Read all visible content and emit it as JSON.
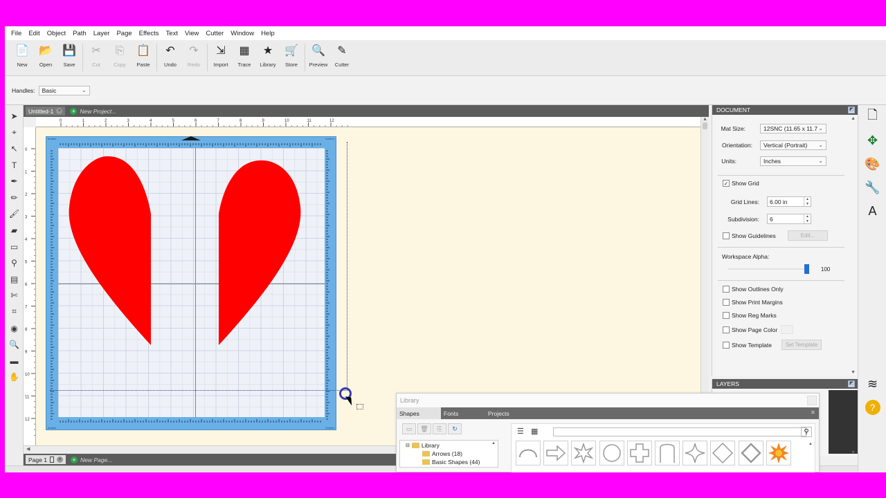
{
  "menu": [
    "File",
    "Edit",
    "Object",
    "Path",
    "Layer",
    "Page",
    "Effects",
    "Text",
    "View",
    "Cutter",
    "Window",
    "Help"
  ],
  "toolbar": [
    {
      "label": "New",
      "icon": "new-icon",
      "glyph": "📄",
      "enabled": true
    },
    {
      "label": "Open",
      "icon": "open-icon",
      "glyph": "📂",
      "enabled": true
    },
    {
      "label": "Save",
      "icon": "save-icon",
      "glyph": "💾",
      "enabled": true
    },
    {
      "label": "Cut",
      "icon": "cut-icon",
      "glyph": "✂",
      "enabled": false
    },
    {
      "label": "Copy",
      "icon": "copy-icon",
      "glyph": "⎘",
      "enabled": false
    },
    {
      "label": "Paste",
      "icon": "paste-icon",
      "glyph": "📋",
      "enabled": true
    },
    {
      "label": "Undo",
      "icon": "undo-icon",
      "glyph": "↶",
      "enabled": true
    },
    {
      "label": "Redo",
      "icon": "redo-icon",
      "glyph": "↷",
      "enabled": false
    },
    {
      "label": "Import",
      "icon": "import-icon",
      "glyph": "⇲",
      "enabled": true
    },
    {
      "label": "Trace",
      "icon": "trace-icon",
      "glyph": "▦",
      "enabled": true
    },
    {
      "label": "Library",
      "icon": "library-icon",
      "glyph": "★",
      "enabled": true
    },
    {
      "label": "Store",
      "icon": "store-icon",
      "glyph": "🛒",
      "enabled": true
    },
    {
      "label": "Preview",
      "icon": "preview-icon",
      "glyph": "🔍",
      "enabled": true
    },
    {
      "label": "Cutter",
      "icon": "cutter-icon",
      "glyph": "✎",
      "enabled": true
    }
  ],
  "options": {
    "handles_label": "Handles:",
    "handles_value": "Basic"
  },
  "tools": [
    "select-arrow-icon",
    "node-edit-icon",
    "tweak-icon",
    "text-tool-icon",
    "pen-icon",
    "pencil-icon",
    "brush-icon",
    "eraser-icon",
    "rectangle-icon",
    "eyedropper-icon",
    "gradient-icon",
    "knife-icon",
    "crop-icon",
    "contour-icon",
    "zoom-icon",
    "measure-icon",
    "hand-icon"
  ],
  "doc_tabs": {
    "active": "Untitled-1",
    "new": "New Project..."
  },
  "page_tabs": {
    "active": "Page 1",
    "new": "New Page..."
  },
  "ruler": {
    "h_ticks": [
      "0",
      "1",
      "2",
      "3",
      "4",
      "5",
      "6",
      "7",
      "8",
      "9",
      "10",
      "11",
      "12"
    ],
    "v_ticks": [
      "0",
      "1",
      "2",
      "3",
      "4",
      "5",
      "6",
      "7",
      "8",
      "9",
      "10",
      "11",
      "12"
    ]
  },
  "mat": {
    "brand": "brother",
    "color": "#6ab0e6"
  },
  "shapes_color": "#ff0000",
  "document_panel": {
    "title": "DOCUMENT",
    "mat_size_label": "Mat Size:",
    "mat_size_value": "12SNC (11.65 x 11.7",
    "orientation_label": "Orientation:",
    "orientation_value": "Vertical (Portrait)",
    "units_label": "Units:",
    "units_value": "Inches",
    "show_grid": "Show Grid",
    "grid_lines_label": "Grid Lines:",
    "grid_lines_value": "6.00 in",
    "subdivision_label": "Subdivision:",
    "subdivision_value": "6",
    "show_guidelines": "Show Guidelines",
    "edit_button": "Edit...",
    "workspace_alpha_label": "Workspace Alpha:",
    "workspace_alpha_value": "100",
    "show_outlines": "Show Outlines Only",
    "show_print_margins": "Show Print Margins",
    "show_reg_marks": "Show Reg Marks",
    "show_page_color": "Show Page Color",
    "show_template": "Show Template",
    "set_template_button": "Set Template"
  },
  "layers_panel": {
    "title": "LAYERS"
  },
  "library": {
    "title": "Library",
    "tabs": [
      "Shapes",
      "Fonts",
      "Projects"
    ],
    "tree": [
      {
        "label": "Library",
        "level": 0
      },
      {
        "label": "Arrows (18)",
        "level": 1
      },
      {
        "label": "Basic Shapes (44)",
        "level": 1
      }
    ],
    "search_placeholder": ""
  },
  "right_dock": [
    "document-settings-icon",
    "move-transform-icon",
    "color-palette-icon",
    "wrench-icon",
    "text-style-icon",
    "layers-icon",
    "help-icon"
  ]
}
